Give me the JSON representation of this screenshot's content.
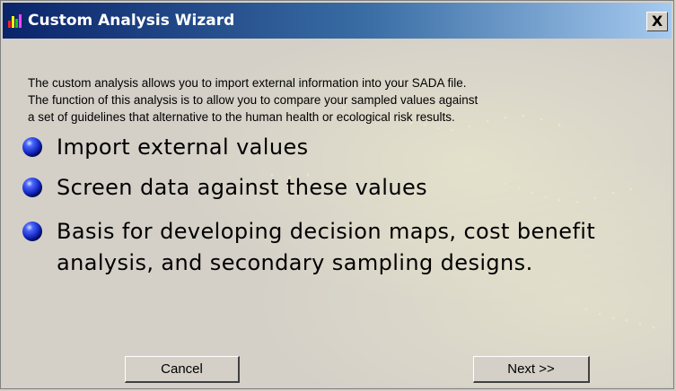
{
  "window": {
    "title": "Custom Analysis Wizard",
    "close_label": "X"
  },
  "intro_lines": [
    "The custom analysis allows you to import external information into your SADA file.",
    "The function of this analysis is to allow you to compare your sampled values against",
    "a set of guidelines that alternative to the human health or ecological risk results."
  ],
  "bullets": [
    "Import external values",
    "Screen data against these values",
    "Basis for developing decision maps, cost benefit analysis, and secondary sampling designs."
  ],
  "buttons": {
    "cancel": "Cancel",
    "next": "Next >>"
  },
  "icons": {
    "app": "bar-chart-icon",
    "bullet": "blue-sphere-bullet-icon"
  },
  "colors": {
    "titlebar_start": "#0a246a",
    "titlebar_end": "#a6caf0",
    "dialog_bg": "#d4d0c8",
    "bullet_blue": "#1a2fd0"
  }
}
